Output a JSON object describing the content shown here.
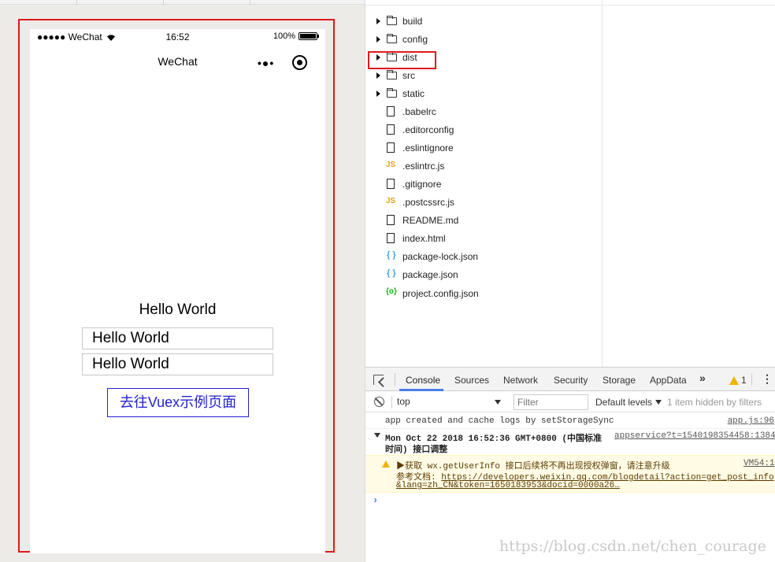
{
  "simulator": {
    "status": {
      "carrier": "●●●●● WeChat",
      "time": "16:52",
      "battery": "100%"
    },
    "navbar": {
      "title": "WeChat",
      "menu": "•●•"
    },
    "content": {
      "hello_text": "Hello World",
      "input1_value": "Hello World",
      "input2_value": "Hello World",
      "button_label": "去往Vuex示例页面"
    }
  },
  "file_tree": {
    "items": [
      {
        "label": "build",
        "type": "folder"
      },
      {
        "label": "config",
        "type": "folder"
      },
      {
        "label": "dist",
        "type": "folder"
      },
      {
        "label": "src",
        "type": "folder"
      },
      {
        "label": "static",
        "type": "folder"
      },
      {
        "label": ".babelrc",
        "type": "file"
      },
      {
        "label": ".editorconfig",
        "type": "file"
      },
      {
        "label": ".eslintignore",
        "type": "file"
      },
      {
        "label": ".eslintrc.js",
        "type": "js"
      },
      {
        "label": ".gitignore",
        "type": "file"
      },
      {
        "label": ".postcssrc.js",
        "type": "js"
      },
      {
        "label": "README.md",
        "type": "file"
      },
      {
        "label": "index.html",
        "type": "file"
      },
      {
        "label": "package-lock.json",
        "type": "json"
      },
      {
        "label": "package.json",
        "type": "json"
      },
      {
        "label": "project.config.json",
        "type": "config"
      }
    ],
    "js_icon_text": "JS",
    "json_icon_text": "{ }",
    "config_icon_text": "{o}"
  },
  "devtools": {
    "tabs": [
      "Console",
      "Sources",
      "Network",
      "Security",
      "Storage",
      "AppData"
    ],
    "more": "»",
    "warn_count": "1",
    "kebab": "⋮",
    "context": "top",
    "filter_placeholder": "Filter",
    "levels": "Default levels",
    "hidden_info": "1 item hidden by filters",
    "logs": {
      "line1_text": "app created and cache logs by setStorageSync",
      "line1_src": "app.js:96",
      "group_text": "Mon Oct 22 2018 16:52:36 GMT+0800 (中国标准",
      "group_text2": "时间) 接口调整",
      "group_src": "appservice?t=1540198354458:1384",
      "warn_line1": "▶获取 wx.getUserInfo 接口后续将不再出现授权弹窗，请注意升级",
      "warn_src": "VM54:1",
      "warn_line2_prefix": "参考文档: ",
      "warn_link": "https://developers.weixin.qq.com/blogdetail?action=get_post_info",
      "warn_line3": "&lang=zh_CN&token=1650183953&docid=0000a26…"
    },
    "prompt": "›",
    "watermark": "https://blog.csdn.net/chen_courage"
  },
  "colors": {
    "highlight_red": "#e0191b",
    "button_blue": "#2222cc",
    "tab_active": "#4a7ee6",
    "warn_yellow": "#f0b400"
  }
}
